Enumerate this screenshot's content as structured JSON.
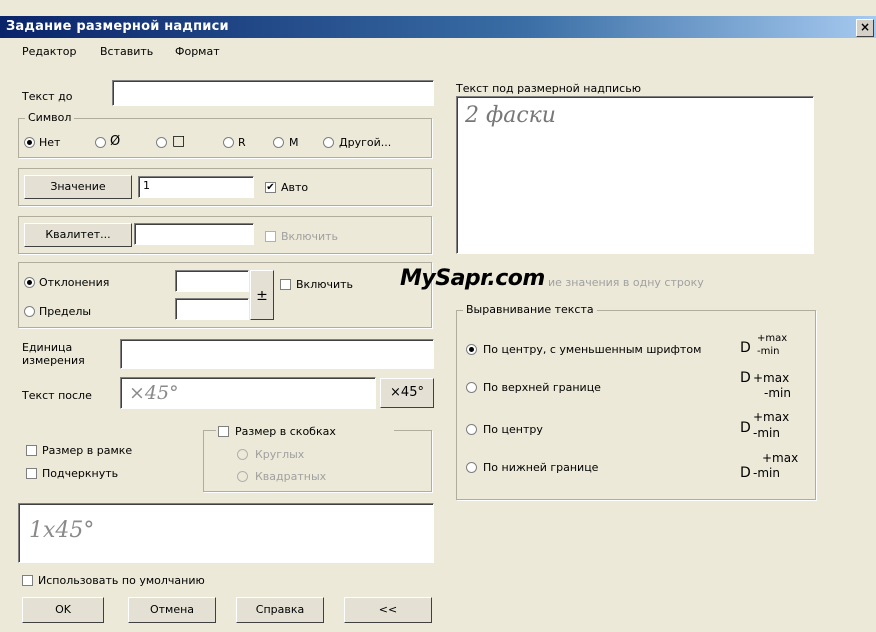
{
  "window": {
    "title": "Задание размерной надписи",
    "close": "×"
  },
  "menu": [
    "Редактор",
    "Вставить",
    "Формат"
  ],
  "text_before": {
    "label": "Текст до",
    "value": ""
  },
  "symbol": {
    "title": "Символ",
    "options": [
      "Нет",
      "Ø",
      "□",
      "R",
      "M",
      "Другой..."
    ]
  },
  "value_row": {
    "button": "Значение",
    "value": "1",
    "auto_label": "Авто",
    "auto_checked": "✔"
  },
  "qualitet_row": {
    "button": "Квалитет...",
    "value": "",
    "enable_label": "Включить"
  },
  "deviation": {
    "opt1": "Отклонения",
    "opt2": "Пределы",
    "pm": "±",
    "enable_label": "Включить"
  },
  "unit": {
    "label_line1": "Единица",
    "label_line2": "измерения",
    "value": ""
  },
  "text_after": {
    "label": "Текст после",
    "value": "×45°",
    "button": "×45°"
  },
  "frame_check": "Размер в рамке",
  "underline_check": "Подчеркнуть",
  "brackets": {
    "title": "Размер в скобках",
    "opt1": "Круглых",
    "opt2": "Квадратных"
  },
  "preview": "1x45°",
  "use_default": "Использовать по умолчанию",
  "buttons": {
    "ok": "OK",
    "cancel": "Отмена",
    "help": "Справка",
    "more": "<<"
  },
  "text_under": {
    "label": "Текст под размерной надписью",
    "value": "2 фаски"
  },
  "watermark": "MySapr.com",
  "one_line_label": "ие значения в одну строку",
  "align": {
    "title": "Выравнивание текста",
    "options": [
      {
        "label": "По центру, с уменьшенным шрифтом",
        "sym": "D",
        "top": "+max",
        "bottom": "-min"
      },
      {
        "label": "По верхней границе",
        "sym": "D",
        "top": "+max",
        "bottom": "-min"
      },
      {
        "label": "По центру",
        "sym": "D",
        "top": "+max",
        "bottom": "-min"
      },
      {
        "label": "По нижней границе",
        "sym": "D",
        "top": "+max",
        "bottom": "-min"
      }
    ]
  }
}
